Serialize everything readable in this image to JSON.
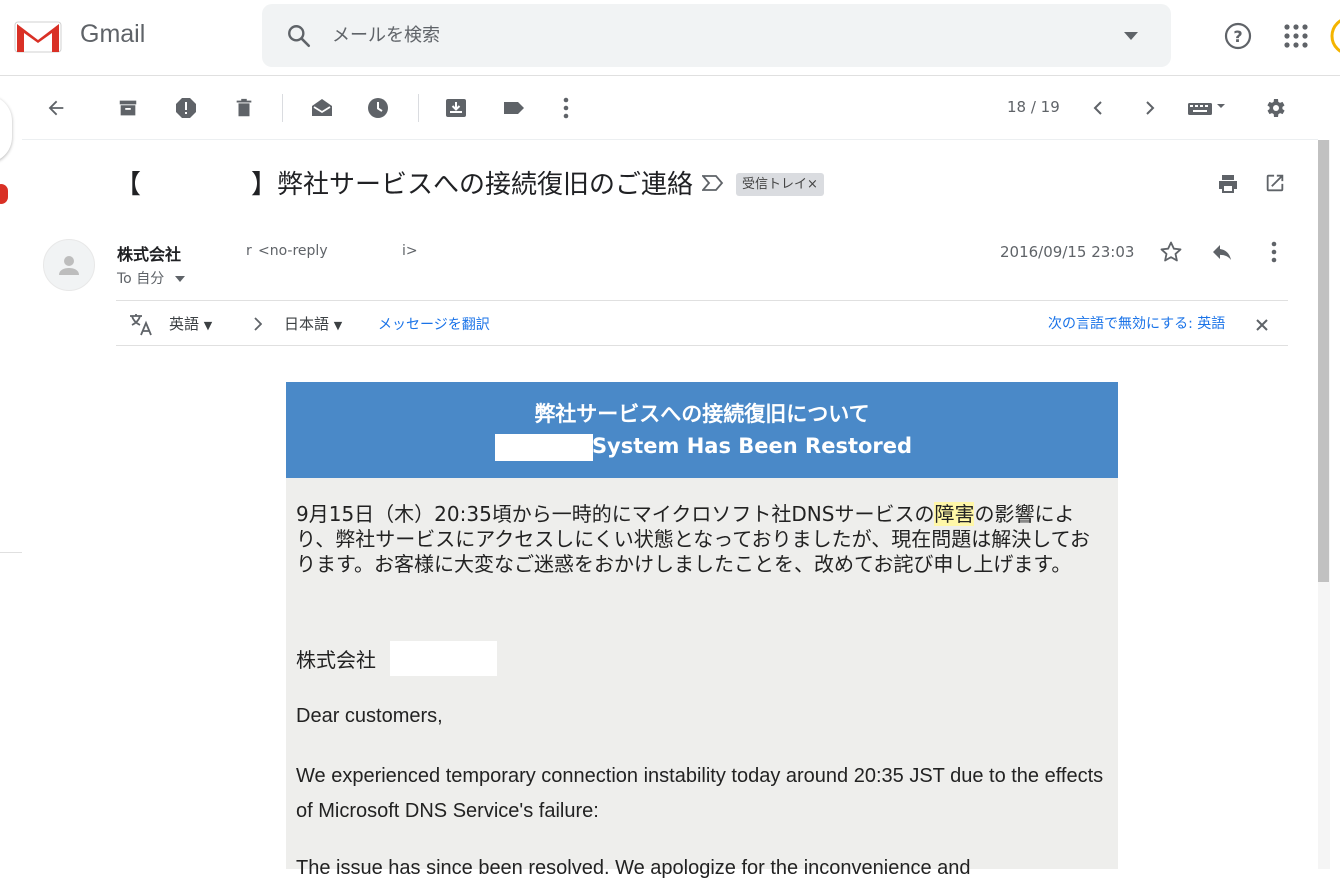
{
  "app": {
    "name": "Gmail"
  },
  "search": {
    "placeholder": "メールを検索"
  },
  "toolbar": {
    "pager": "18 / 19"
  },
  "email": {
    "subject_open": "【",
    "subject_text": "】弊社サービスへの接続復旧のご連絡",
    "label": "受信トレイ",
    "label_remove": "×",
    "sender_name": "株式会社",
    "sender_extra": "r",
    "sender_email": "<no-reply",
    "sender_email_end": "i>",
    "to": "To 自分",
    "date": "2016/09/15 23:03"
  },
  "translate": {
    "from_lang": "英語",
    "to_lang": "日本語",
    "translate_link": "メッセージを翻訳",
    "disable_link": "次の言語で無効にする: 英語"
  },
  "body": {
    "banner_line1": "弊社サービスへの接続復旧について",
    "banner_line2": "System Has Been Restored",
    "jp_before": "9月15日（木）20:35頃から一時的にマイクロソフト社DNSサービスの",
    "jp_highlight": "障害",
    "jp_after": "の影響により、弊社サービスにアクセスしにくい状態となっておりましたが、現在問題は解決しております。お客様に大変なご迷惑をおかけしましたことを、改めてお詫び申し上げます。",
    "jp_sign": "株式会社",
    "greeting": "Dear customers,",
    "para1": "We experienced temporary connection instability today around 20:35 JST due to the effects of Microsoft DNS Service's failure:",
    "para2": "The issue has since been resolved. We apologize for the inconvenience and"
  },
  "colors": {
    "banner": "#4a89c8",
    "body_bg": "#eeeeec",
    "gmail_red": "#d93025"
  }
}
